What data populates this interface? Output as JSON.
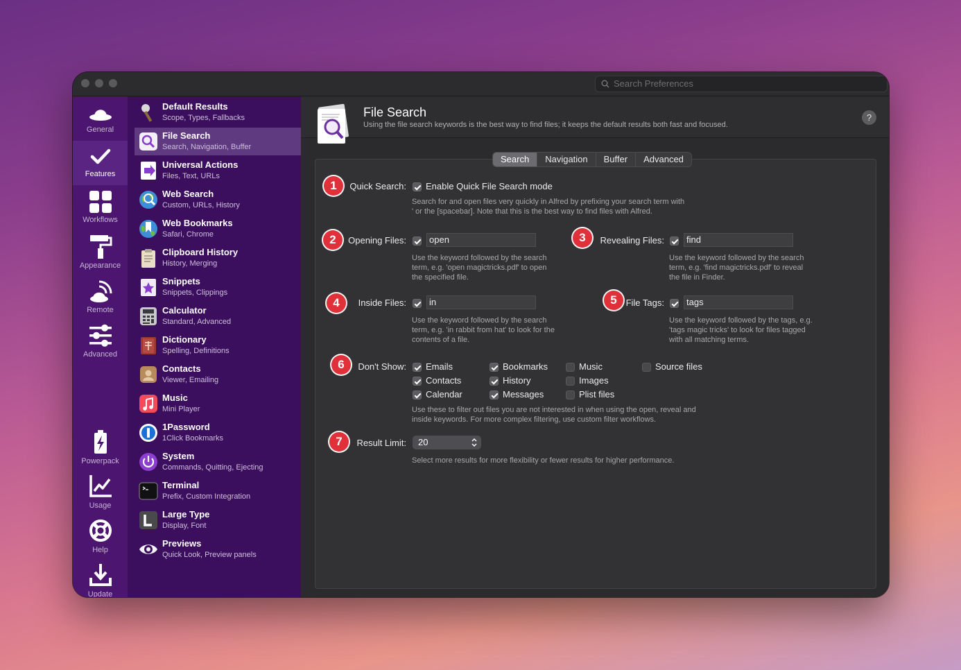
{
  "search": {
    "placeholder": "Search Preferences"
  },
  "iconbar": [
    {
      "label": "General",
      "icon": "hat-icon"
    },
    {
      "label": "Features",
      "icon": "checkmark-icon"
    },
    {
      "label": "Workflows",
      "icon": "grid-icon"
    },
    {
      "label": "Appearance",
      "icon": "paint-roller-icon"
    },
    {
      "label": "Remote",
      "icon": "remote-icon"
    },
    {
      "label": "Advanced",
      "icon": "sliders-icon"
    },
    {
      "label": "Powerpack",
      "icon": "battery-icon"
    },
    {
      "label": "Usage",
      "icon": "chart-icon"
    },
    {
      "label": "Help",
      "icon": "lifebuoy-icon"
    },
    {
      "label": "Update",
      "icon": "download-icon"
    }
  ],
  "features": [
    {
      "title": "Default Results",
      "sub": "Scope, Types, Fallbacks",
      "color": "#3c0f5e"
    },
    {
      "title": "File Search",
      "sub": "Search, Navigation, Buffer",
      "color": "#f4f0f8"
    },
    {
      "title": "Universal Actions",
      "sub": "Files, Text, URLs",
      "color": "#8a3ccc"
    },
    {
      "title": "Web Search",
      "sub": "Custom, URLs, History",
      "color": "#3f8ed8"
    },
    {
      "title": "Web Bookmarks",
      "sub": "Safari, Chrome",
      "color": "#3f8ed8"
    },
    {
      "title": "Clipboard History",
      "sub": "History, Merging",
      "color": "#e9dfc7"
    },
    {
      "title": "Snippets",
      "sub": "Snippets, Clippings",
      "color": "#f1ecf6"
    },
    {
      "title": "Calculator",
      "sub": "Standard, Advanced",
      "color": "#c9c9cc"
    },
    {
      "title": "Dictionary",
      "sub": "Spelling, Definitions",
      "color": "#9a3a32"
    },
    {
      "title": "Contacts",
      "sub": "Viewer, Emailing",
      "color": "#b98a5c"
    },
    {
      "title": "Music",
      "sub": "Mini Player",
      "color": "#f44a5e"
    },
    {
      "title": "1Password",
      "sub": "1Click Bookmarks",
      "color": "#1a6fd8"
    },
    {
      "title": "System",
      "sub": "Commands, Quitting, Ejecting",
      "color": "#8c3ecf"
    },
    {
      "title": "Terminal",
      "sub": "Prefix, Custom Integration",
      "color": "#111114"
    },
    {
      "title": "Large Type",
      "sub": "Display, Font",
      "color": "#4a4a4d"
    },
    {
      "title": "Previews",
      "sub": "Quick Look, Preview panels",
      "color": "#f2f2f4"
    }
  ],
  "header": {
    "title": "File Search",
    "subtitle": "Using the file search keywords is the best way to find files; it keeps the default results both fast and focused.",
    "help": "?"
  },
  "tabs": [
    "Search",
    "Navigation",
    "Buffer",
    "Advanced"
  ],
  "form": {
    "quick_search": {
      "badge": "1",
      "label": "Quick Search:",
      "checkbox_label": "Enable Quick File Search mode",
      "desc1": "Search for and open files very quickly in Alfred by prefixing your search term with",
      "desc2": "' or the [spacebar]. Note that this is the best way to find files with Alfred."
    },
    "opening": {
      "badge": "2",
      "label": "Opening Files:",
      "value": "open",
      "desc1": "Use the keyword followed by the search",
      "desc2": "term, e.g. 'open magictricks.pdf' to open",
      "desc3": "the specified file."
    },
    "revealing": {
      "badge": "3",
      "label": "Revealing Files:",
      "value": "find",
      "desc1": "Use the keyword followed by the search",
      "desc2": "term, e.g. 'find magictricks.pdf' to reveal",
      "desc3": "the file in Finder."
    },
    "inside": {
      "badge": "4",
      "label": "Inside Files:",
      "value": "in",
      "desc1": "Use the keyword followed by the search",
      "desc2": "term, e.g. 'in rabbit from hat' to look for the",
      "desc3": "contents of a file."
    },
    "tags": {
      "badge": "5",
      "label": "File Tags:",
      "value": "tags",
      "desc1": "Use the keyword followed by the tags, e.g.",
      "desc2": "'tags magic tricks' to look for files tagged",
      "desc3": "with all matching terms."
    },
    "dont_show": {
      "badge": "6",
      "label": "Don't Show:",
      "options": [
        {
          "label": "Emails",
          "checked": true
        },
        {
          "label": "Contacts",
          "checked": true
        },
        {
          "label": "Calendar",
          "checked": true
        },
        {
          "label": "Bookmarks",
          "checked": true
        },
        {
          "label": "History",
          "checked": true
        },
        {
          "label": "Messages",
          "checked": true
        },
        {
          "label": "Music",
          "checked": false
        },
        {
          "label": "Images",
          "checked": false
        },
        {
          "label": "Plist files",
          "checked": false
        },
        {
          "label": "Source files",
          "checked": false
        }
      ],
      "desc1": "Use these to filter out files you are not interested in when using the open, reveal and",
      "desc2": "inside keywords. For more complex filtering, use custom filter workflows."
    },
    "result_limit": {
      "badge": "7",
      "label": "Result Limit:",
      "value": "20",
      "desc": "Select more results for more flexibility or fewer results for higher performance."
    }
  }
}
